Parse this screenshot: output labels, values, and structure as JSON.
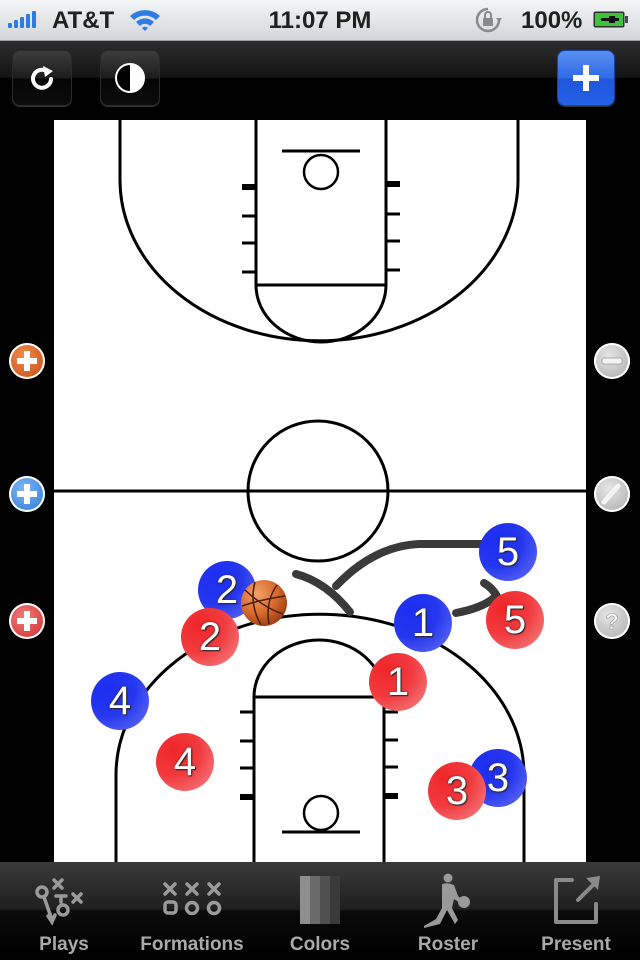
{
  "status_bar": {
    "carrier": "AT&T",
    "time": "11:07 PM",
    "battery_percent": "100%",
    "signal_bars": 5,
    "wifi": true,
    "orientation_lock": true,
    "charging": true
  },
  "toolbar": {
    "left_buttons": [
      {
        "name": "redo",
        "icon": "refresh-icon"
      },
      {
        "name": "toggle-contrast",
        "icon": "contrast-icon"
      }
    ],
    "right_button": {
      "name": "add",
      "icon": "plus-icon",
      "color": "#2f6ae6"
    }
  },
  "side_controls": {
    "left": [
      {
        "name": "add-ball",
        "icon": "plus-icon",
        "color": "#e0702f"
      },
      {
        "name": "add-blue-player",
        "icon": "plus-icon",
        "color": "#3a8ae6"
      },
      {
        "name": "add-red-player",
        "icon": "plus-icon",
        "color": "#e33c3c"
      }
    ],
    "right": [
      {
        "name": "remove",
        "icon": "minus-icon"
      },
      {
        "name": "draw",
        "icon": "pencil-icon"
      },
      {
        "name": "help",
        "icon": "question-icon"
      }
    ]
  },
  "court": {
    "colors": {
      "blue_team": "#2436ee",
      "red_team": "#f13a3e",
      "path": "#3a3a3a"
    },
    "markers": [
      {
        "team": "blue",
        "number": "2"
      },
      {
        "team": "red",
        "number": "2"
      },
      {
        "team": "blue",
        "number": "5"
      },
      {
        "team": "blue",
        "number": "1"
      },
      {
        "team": "red",
        "number": "5"
      },
      {
        "team": "red",
        "number": "1"
      },
      {
        "team": "blue",
        "number": "4"
      },
      {
        "team": "red",
        "number": "4"
      },
      {
        "team": "blue",
        "number": "3"
      },
      {
        "team": "red",
        "number": "3"
      }
    ],
    "ball": "basketball-icon"
  },
  "tabbar": {
    "tabs": [
      {
        "label": "Plays",
        "icon": "plays-icon"
      },
      {
        "label": "Formations",
        "icon": "formations-icon"
      },
      {
        "label": "Colors",
        "icon": "colors-icon"
      },
      {
        "label": "Roster",
        "icon": "roster-icon"
      },
      {
        "label": "Present",
        "icon": "present-icon"
      }
    ]
  }
}
